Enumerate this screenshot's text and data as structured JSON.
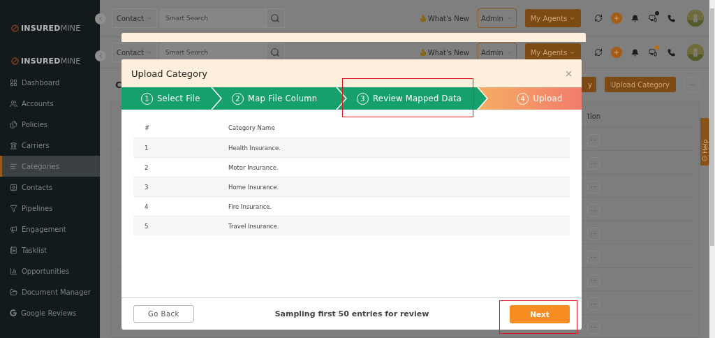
{
  "layers": [
    {
      "brand": "**INSURED**MINE",
      "header": {
        "scope": "Contact",
        "search": {
          "placeholder": "Smart Search"
        },
        "whats_new": "What's New",
        "role": "Admin",
        "agents": "My Agents",
        "badge": {
          "color": "#1c1c1c"
        }
      }
    },
    {
      "brand": "**INSURED**MINE",
      "header": {
        "scope": "Contact",
        "search": {
          "placeholder": "Smart Search"
        },
        "whats_new": "What's New",
        "role": "Admin",
        "agents": "My Agents",
        "badge": {
          "color": "#c26b12"
        }
      }
    }
  ],
  "sidebar": {
    "items": [
      {
        "label": "Dashboard",
        "kind": "dashboard",
        "selected": false
      },
      {
        "label": "Accounts",
        "kind": "accounts",
        "selected": false
      },
      {
        "label": "Policies",
        "kind": "policies",
        "selected": false
      },
      {
        "label": "Carriers",
        "kind": "carriers",
        "selected": false
      },
      {
        "label": "Categories",
        "kind": "categories",
        "selected": true
      },
      {
        "label": "Contacts",
        "kind": "contacts",
        "selected": false
      },
      {
        "label": "Pipelines",
        "kind": "pipelines",
        "selected": false
      },
      {
        "label": "Engagement",
        "kind": "engagement",
        "selected": false
      },
      {
        "label": "Tasklist",
        "kind": "tasklist",
        "selected": false
      },
      {
        "label": "Opportunities",
        "kind": "opportunities",
        "selected": false
      },
      {
        "label": "Document Manager",
        "kind": "documents",
        "selected": false
      },
      {
        "label": "Google Reviews",
        "kind": "google",
        "selected": false
      }
    ]
  },
  "page": {
    "title": "C",
    "buttons": [
      "y",
      "Upload Category"
    ],
    "more": "···",
    "table": {
      "column_2": "tion",
      "rows": [
        {
          "action": "···"
        },
        {
          "action": "···"
        },
        {
          "action": "···"
        },
        {
          "action": "···"
        },
        {
          "action": "···"
        },
        {
          "action": "···"
        },
        {
          "action": "···"
        },
        {
          "action": "···"
        },
        {
          "action": "···"
        }
      ]
    },
    "help_tab": "Help"
  },
  "modal": {
    "title": "Upload Category",
    "steps": [
      {
        "number": "1",
        "label": "Select File",
        "completed": true,
        "highlighted": false
      },
      {
        "number": "2",
        "label": "Map File Column",
        "completed": true,
        "highlighted": false
      },
      {
        "number": "3",
        "label": "Review Mapped Data",
        "completed": true,
        "highlighted": true
      },
      {
        "number": "4",
        "label": "Upload",
        "completed": false,
        "highlighted": false
      }
    ],
    "table": {
      "columns": [
        "#",
        "Category Name"
      ],
      "rows": [
        {
          "index": "1",
          "name": "Health Insurance."
        },
        {
          "index": "2",
          "name": "Motor Insurance."
        },
        {
          "index": "3",
          "name": "Home Insurance."
        },
        {
          "index": "4",
          "name": "Fire Insurance."
        },
        {
          "index": "5",
          "name": "Travel Insurance."
        }
      ]
    },
    "footer": {
      "back": "Go Back",
      "note": "Sampling first 50 entries for review",
      "next": {
        "label": "Next",
        "highlighted": true
      }
    }
  }
}
